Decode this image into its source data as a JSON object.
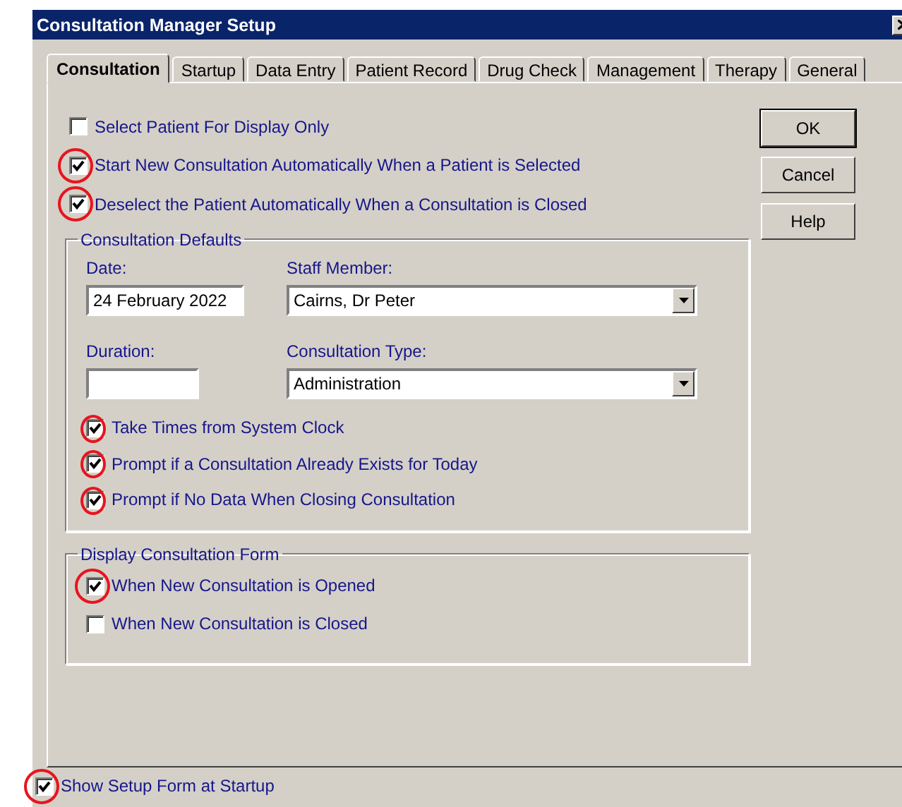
{
  "window": {
    "title": "Consultation Manager Setup"
  },
  "tabs": [
    {
      "label": "Consultation",
      "selected": true
    },
    {
      "label": "Startup",
      "selected": false
    },
    {
      "label": "Data Entry",
      "selected": false
    },
    {
      "label": "Patient Record",
      "selected": false
    },
    {
      "label": "Drug Check",
      "selected": false
    },
    {
      "label": "Management",
      "selected": false
    },
    {
      "label": "Therapy",
      "selected": false
    },
    {
      "label": "General",
      "selected": false
    }
  ],
  "options": [
    {
      "label": "Select Patient For Display Only",
      "checked": false,
      "circled": false
    },
    {
      "label": "Start New Consultation Automatically When a Patient is Selected",
      "checked": true,
      "circled": true
    },
    {
      "label": "Deselect the Patient Automatically When a Consultation is Closed",
      "checked": true,
      "circled": true
    }
  ],
  "consultation_defaults": {
    "title": "Consultation Defaults",
    "date": {
      "label": "Date:",
      "value": "24 February 2022"
    },
    "staff_member": {
      "label": "Staff Member:",
      "value": "Cairns, Dr Peter"
    },
    "duration": {
      "label": "Duration:"
    },
    "consultation_type": {
      "label": "Consultation Type:",
      "value": "Administration"
    },
    "options": [
      {
        "label": "Take Times from System Clock",
        "checked": true,
        "circled": true
      },
      {
        "label": "Prompt if a Consultation Already Exists for Today",
        "checked": true,
        "circled": true
      },
      {
        "label": "Prompt if No Data When Closing Consultation",
        "checked": true,
        "circled": true
      }
    ]
  },
  "display_form": {
    "title": "Display Consultation Form",
    "options": [
      {
        "label": "When New Consultation is Opened",
        "checked": true,
        "circled": true
      },
      {
        "label": "When New Consultation is Closed",
        "checked": false,
        "circled": false
      }
    ]
  },
  "buttons": [
    "OK",
    "Cancel",
    "Help"
  ],
  "footer_option": {
    "label": "Show Setup Form at Startup",
    "checked": true,
    "circled": true
  }
}
